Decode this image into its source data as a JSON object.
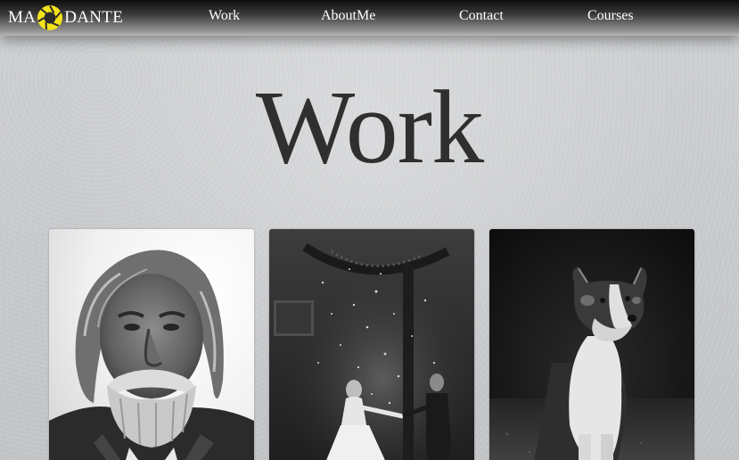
{
  "brand": {
    "name_left": "MA",
    "name_right": "DANTE",
    "logo_icon": "camera-aperture-icon",
    "accent_color": "#f5e21a"
  },
  "nav": {
    "items": [
      {
        "label": "Work"
      },
      {
        "label": "AboutMe"
      },
      {
        "label": "Contact"
      },
      {
        "label": "Courses"
      }
    ]
  },
  "hero": {
    "title": "Work"
  },
  "gallery": {
    "items": [
      {
        "subject": "bearded-elderly-man-portrait"
      },
      {
        "subject": "wedding-couple-dancing"
      },
      {
        "subject": "border-collie-dog"
      }
    ]
  }
}
